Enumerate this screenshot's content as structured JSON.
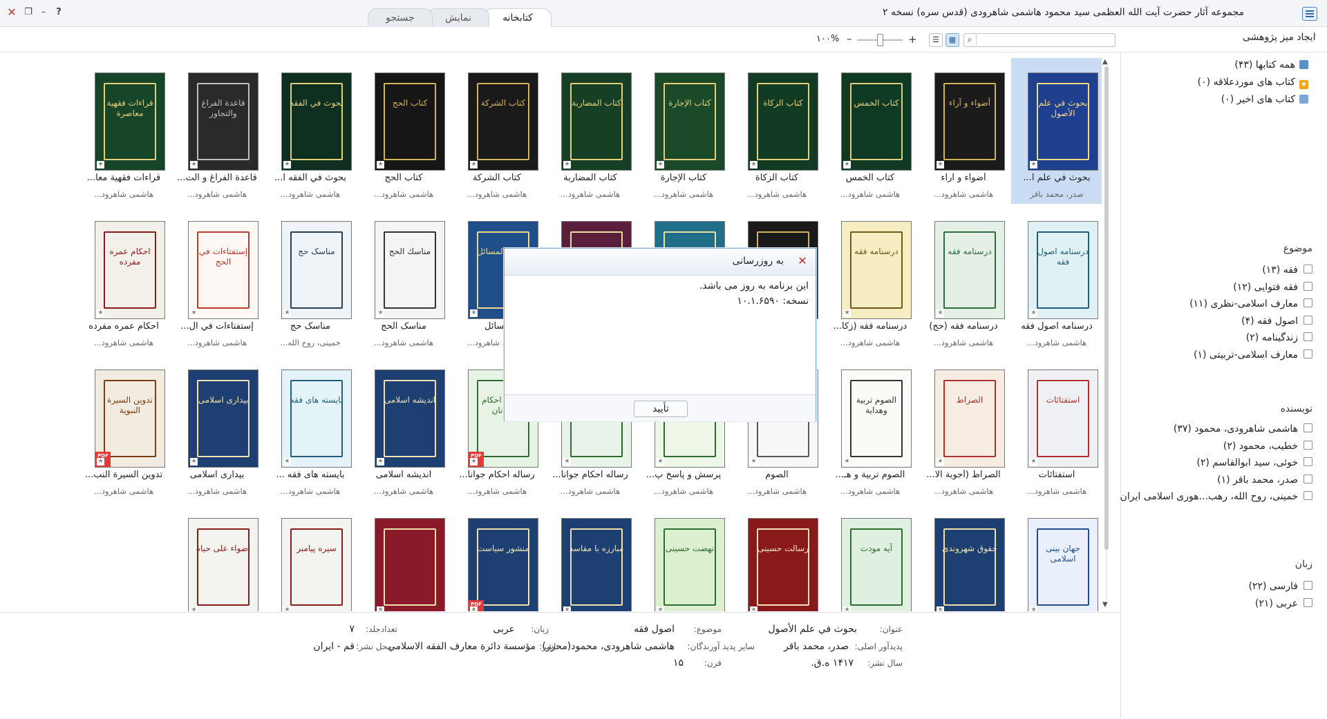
{
  "window": {
    "title": "مجموعه آثار حضرت آیت الله العظمی سید محمود هاشمی شاهرودی (قدس سره) نسخه ۲"
  },
  "tabs": [
    "کتابخانه",
    "نمایش",
    "جستجو"
  ],
  "toolbar": {
    "research_label": "ایجاد میز پژوهشی",
    "search_placeholder": "",
    "zoom": "۱۰۰%"
  },
  "sidebar": {
    "library": [
      {
        "label": "همه کتابها (۴۳)",
        "icon": "books-icon"
      },
      {
        "label": "کتاب های موردعلاقه (۰)",
        "icon": "star-icon"
      },
      {
        "label": "کتاب های اخیر (۰)",
        "icon": "recent-books-icon"
      }
    ],
    "topic_header": "موضوع",
    "topics": [
      "فقه (۱۳)",
      "فقه فتوایی (۱۲)",
      "معارف اسلامی-نظری (۱۱)",
      "اصول فقه (۴)",
      "زندگینامه (۲)",
      "معارف اسلامی-تربیتی (۱)"
    ],
    "author_header": "نویسنده",
    "authors": [
      "هاشمی شاهرودی، محمود (۳۷)",
      "خطیب، محمود (۲)",
      "خوئی، سید ابوالقاسم (۲)",
      "صدر، محمد باقر (۱)",
      "خمینی، روح الله، رهب...هوری اسلامی ایران"
    ],
    "language_header": "زبان",
    "languages": [
      "فارسی (۲۲)",
      "عربی (۲۱)"
    ]
  },
  "books": [
    [
      {
        "title": "بحوث في علم ا...",
        "author": "صدر، محمد باقر",
        "bg": "#1f3f8f",
        "fg": "#f2d98a",
        "cover_text": "بحوث في علم الأصول",
        "selected": true
      },
      {
        "title": "أضواء و آراء",
        "author": "هاشمی شاهرود...",
        "bg": "#1b1b1b",
        "fg": "#d4b45a",
        "cover_text": "أضواء و آراء"
      },
      {
        "title": "کتاب الخمس",
        "author": "هاشمی شاهرود...",
        "bg": "#0f3a24",
        "fg": "#e6cf7a",
        "cover_text": "كتاب الخمس"
      },
      {
        "title": "کتاب الزکاة",
        "author": "هاشمی شاهرود...",
        "bg": "#123b23",
        "fg": "#e6cf7a",
        "cover_text": "كتاب الزكاة"
      },
      {
        "title": "کتاب الإجارة",
        "author": "هاشمی شاهرود...",
        "bg": "#1a4a2a",
        "fg": "#e6cf7a",
        "cover_text": "كتاب الإجارة"
      },
      {
        "title": "کتاب المضاربة",
        "author": "هاشمی شاهرود...",
        "bg": "#163f25",
        "fg": "#e6cf7a",
        "cover_text": "كتاب المضاربة"
      },
      {
        "title": "کتاب الشرکة",
        "author": "هاشمی شاهرود...",
        "bg": "#1a1a1a",
        "fg": "#d4b45a",
        "cover_text": "كتاب الشركة"
      },
      {
        "title": "کتاب الحج",
        "author": "هاشمی شاهرود...",
        "bg": "#161616",
        "fg": "#d4b45a",
        "cover_text": "كتاب الحج"
      },
      {
        "title": "بحوث في الفقه ا...",
        "author": "هاشمی شاهرود...",
        "bg": "#0f2f20",
        "fg": "#e6cf7a",
        "cover_text": "بحوث في الفقه"
      },
      {
        "title": "قاعدة الفراغ و الت...",
        "author": "هاشمی شاهرود...",
        "bg": "#2a2a2a",
        "fg": "#bfbfbf",
        "cover_text": "قاعدة الفراغ والتجاوز"
      },
      {
        "title": "قراءات فقهية معا...",
        "author": "هاشمی شاهرود...",
        "bg": "#17452a",
        "fg": "#e6cf7a",
        "cover_text": "قراءات فقهية معاصرة"
      }
    ],
    [
      {
        "title": "درسنامه اصول فقه",
        "author": "هاشمی شاهرود...",
        "bg": "#dff1f5",
        "fg": "#1f5d7a",
        "cover_text": "درسنامه اصول فقه"
      },
      {
        "title": "درسنامه فقه (حج)",
        "author": "هاشمی شاهرود...",
        "bg": "#e4f0e6",
        "fg": "#2c6b3f",
        "cover_text": "درسنامه فقه"
      },
      {
        "title": "درسنامه فقه (زکا...",
        "author": "هاشمی شاهرود...",
        "bg": "#f6edc2",
        "fg": "#6b5a1c",
        "cover_text": "درسنامه فقه"
      },
      {
        "title": "",
        "author": "",
        "bg": "#1a1a1a",
        "fg": "#d4b45a",
        "cover_text": ""
      },
      {
        "title": "",
        "author": "",
        "bg": "#1f6f8a",
        "fg": "#f0e0a0",
        "cover_text": ""
      },
      {
        "title": "",
        "author": "",
        "bg": "#5a1f3a",
        "fg": "#f0d9a0",
        "cover_text": ""
      },
      {
        "title": "مسائل",
        "author": "هاشمی شاهرود...",
        "bg": "#1f4f8a",
        "fg": "#f2d98a",
        "cover_text": "توضيح المسائل"
      },
      {
        "title": "مناسک الحج",
        "author": "هاشمی شاهرود...",
        "bg": "#f4f4f4",
        "fg": "#333",
        "cover_text": "مناسك الحج"
      },
      {
        "title": "مناسک حج",
        "author": "خمینی، روح الله...",
        "bg": "#eef3f8",
        "fg": "#2c3e50",
        "cover_text": "مناسک حج"
      },
      {
        "title": "إستفتاءات في ال...",
        "author": "هاشمی شاهرود...",
        "bg": "#fdf8f4",
        "fg": "#c0392b",
        "cover_text": "إستفتاءات في الحج"
      },
      {
        "title": "احکام عمره مفرده",
        "author": "هاشمی شاهرود...",
        "bg": "#f3f0ea",
        "fg": "#8b1a1a",
        "cover_text": "احکام عمره مفرده"
      }
    ],
    [
      {
        "title": "استفتائات",
        "author": "هاشمی شاهرود...",
        "bg": "#eef0f3",
        "fg": "#b03030",
        "cover_text": "استفتائات"
      },
      {
        "title": "الصراط (أجوبة الا...",
        "author": "هاشمی شاهرود...",
        "bg": "#f6ece2",
        "fg": "#b03030",
        "cover_text": "الصراط"
      },
      {
        "title": "الصوم تربية و هـ...",
        "author": "هاشمی شاهرود...",
        "bg": "#fbfaf7",
        "fg": "#333",
        "cover_text": "الصوم تربية وهداية"
      },
      {
        "title": "الصوم",
        "author": "هاشمی شاهرود...",
        "bg": "#f7f7f7",
        "fg": "#555",
        "cover_text": "الصوم"
      },
      {
        "title": "پرسش و پاسخ پ...",
        "author": "هاشمی شاهرود...",
        "bg": "#eef6e8",
        "fg": "#2e6b2e",
        "cover_text": "پرسش و پاسخ"
      },
      {
        "title": "رساله احکام جوانا...",
        "author": "هاشمی شاهرود...",
        "bg": "#e8f4ea",
        "fg": "#2e6b2e",
        "cover_text": "رساله احکام"
      },
      {
        "title": "رساله احکام جوانا...",
        "author": "هاشمی شاهرود...",
        "bg": "#e7f3e5",
        "fg": "#2e6b2e",
        "cover_text": "رساله احکام جوانان",
        "pdf": true
      },
      {
        "title": "اندیشه اسلامی",
        "author": "هاشمی شاهرود...",
        "bg": "#1d3f72",
        "fg": "#f2e2b0",
        "cover_text": "اندیشه اسلامی"
      },
      {
        "title": "بایسته های فقه ...",
        "author": "هاشمی شاهرود...",
        "bg": "#e3f3f8",
        "fg": "#1f5d7a",
        "cover_text": "بایسته های فقه"
      },
      {
        "title": "بیداری اسلامی",
        "author": "هاشمی شاهرود...",
        "bg": "#1d3f72",
        "fg": "#f2e2b0",
        "cover_text": "بیداری اسلامی"
      },
      {
        "title": "تدوين السيرة النب...",
        "author": "هاشمی شاهرود...",
        "bg": "#f2ebdf",
        "fg": "#7a3b12",
        "cover_text": "تدوين السيرة النبوية",
        "pdf": true
      }
    ],
    [
      {
        "title": "",
        "author": "",
        "bg": "#eaf0fb",
        "fg": "#1f4f8a",
        "cover_text": "جهان بینی اسلامی"
      },
      {
        "title": "",
        "author": "",
        "bg": "#1d3f72",
        "fg": "#f2e2b0",
        "cover_text": "حقوق شهروندی"
      },
      {
        "title": "",
        "author": "",
        "bg": "#dff0e0",
        "fg": "#2e6b2e",
        "cover_text": "آیه مودت"
      },
      {
        "title": "",
        "author": "",
        "bg": "#8a1a1a",
        "fg": "#f7e3c0",
        "cover_text": "رسالت حسینی"
      },
      {
        "title": "",
        "author": "",
        "bg": "#dcefcf",
        "fg": "#2e6b2e",
        "cover_text": "نهضت حسینی"
      },
      {
        "title": "",
        "author": "",
        "bg": "#1d3f72",
        "fg": "#f2e2b0",
        "cover_text": "مبارزه با مفاسد"
      },
      {
        "title": "",
        "author": "",
        "bg": "#1d3f72",
        "fg": "#f2e2b0",
        "cover_text": "منشور سیاست",
        "pdf": true
      },
      {
        "title": "",
        "author": "",
        "bg": "#8a1a2a",
        "fg": "#f2e2b0",
        "cover_text": ""
      },
      {
        "title": "",
        "author": "",
        "bg": "#f3f3f0",
        "fg": "#8b1a1a",
        "cover_text": "سیره پیامبر"
      },
      {
        "title": "",
        "author": "",
        "bg": "#f3f3f0",
        "fg": "#8b1a1a",
        "cover_text": "اضواء علی حیاة"
      }
    ]
  ],
  "details": {
    "title_label": "عنوان:",
    "title_value": "بحوث في علم الأصول",
    "topic_label": "موضوع:",
    "topic_value": "اصول فقه",
    "lang_label": "زبان:",
    "lang_value": "عربی",
    "volumes_label": "تعدادجلد:",
    "volumes_value": "۷",
    "creator_label": "پدیدآور اصلی:",
    "creator_value": "صدر، محمد باقر",
    "others_label": "سایر پدید آورندگان:",
    "others_value": "هاشمی شاهرودی، محمود(محرر)",
    "publisher_label": "ناشر:",
    "publisher_value": "مؤسسة دائرة معارف الفقه الاسلامي",
    "place_label": "محل نشر:",
    "place_value": "قم - ایران",
    "year_label": "سال نشر:",
    "year_value": "۱۴۱۷ ه.ق.",
    "century_label": "قرن:",
    "century_value": "۱۵"
  },
  "dialog": {
    "title": "به روزرسانی",
    "message": "این برنامه به روز می باشد.",
    "version": "نسخه: ۱۰.۱.۶۵۹۰",
    "ok_label": "تأیید"
  }
}
